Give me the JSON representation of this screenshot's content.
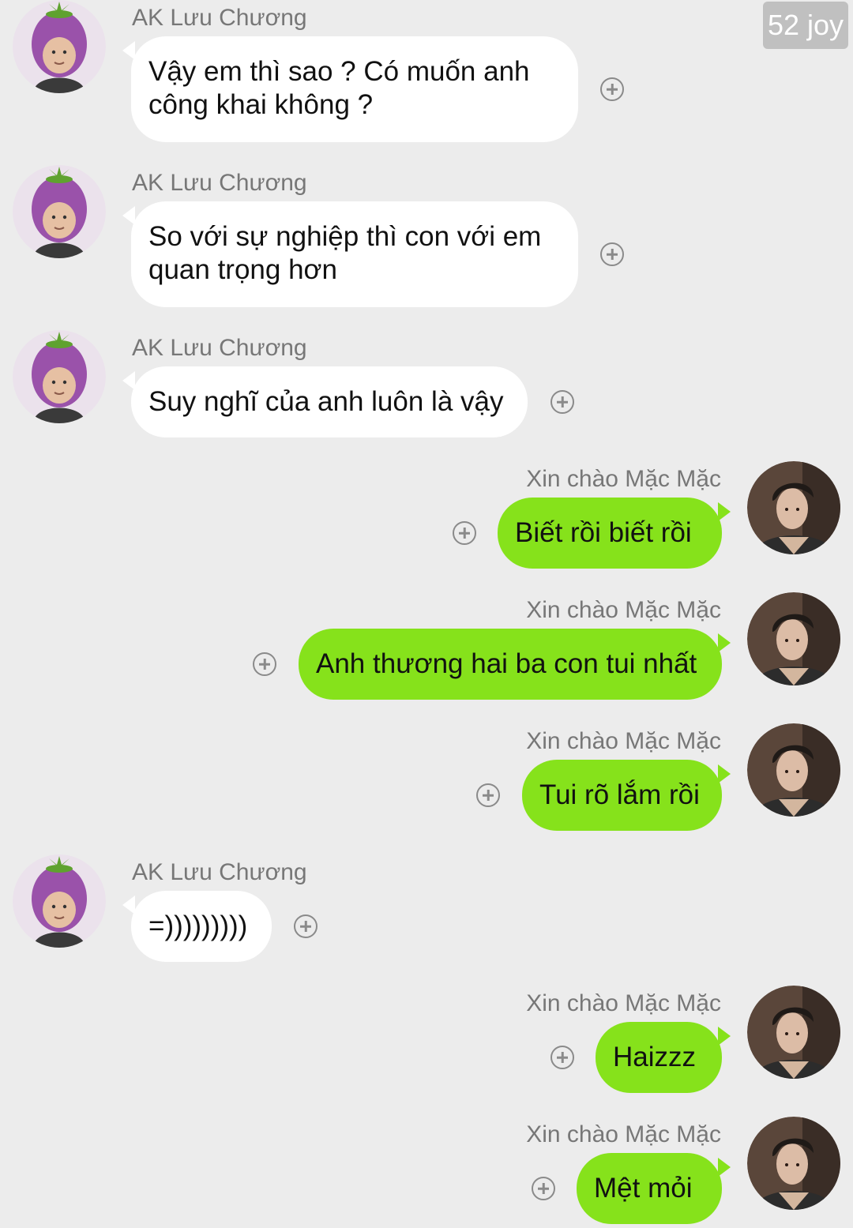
{
  "watermark": "52 joy",
  "contacts": {
    "left_name": "AK Lưu Chương",
    "right_name": "Xin chào Mặc Mặc"
  },
  "messages": [
    {
      "side": "in",
      "sender": "AK Lưu Chương",
      "text": "Vậy em thì sao ? Có muốn anh\ncông khai không ?"
    },
    {
      "side": "in",
      "sender": "AK Lưu Chương",
      "text": "So với sự nghiệp thì con với em\nquan trọng hơn"
    },
    {
      "side": "in",
      "sender": "AK Lưu Chương",
      "text": "Suy nghĩ của anh luôn là vậy"
    },
    {
      "side": "out",
      "sender": "Xin chào Mặc Mặc",
      "text": "Biết rồi biết rồi"
    },
    {
      "side": "out",
      "sender": "Xin chào Mặc Mặc",
      "text": "Anh thương hai ba con tui nhất"
    },
    {
      "side": "out",
      "sender": "Xin chào Mặc Mặc",
      "text": "Tui rõ lắm rồi"
    },
    {
      "side": "in",
      "sender": "AK Lưu Chương",
      "text": "=)))))))))"
    },
    {
      "side": "out",
      "sender": "Xin chào Mặc Mặc",
      "text": "Haizzz"
    },
    {
      "side": "out",
      "sender": "Xin chào Mặc Mặc",
      "text": "Mệt mỏi"
    }
  ],
  "icons": {
    "react": "add-reaction-icon",
    "left_avatar": "eggplant-hat-avatar",
    "right_avatar": "profile-photo-avatar"
  },
  "colors": {
    "background": "#ececec",
    "incoming_bubble": "#ffffff",
    "outgoing_bubble": "#86e21b",
    "sender_text": "#777777"
  }
}
